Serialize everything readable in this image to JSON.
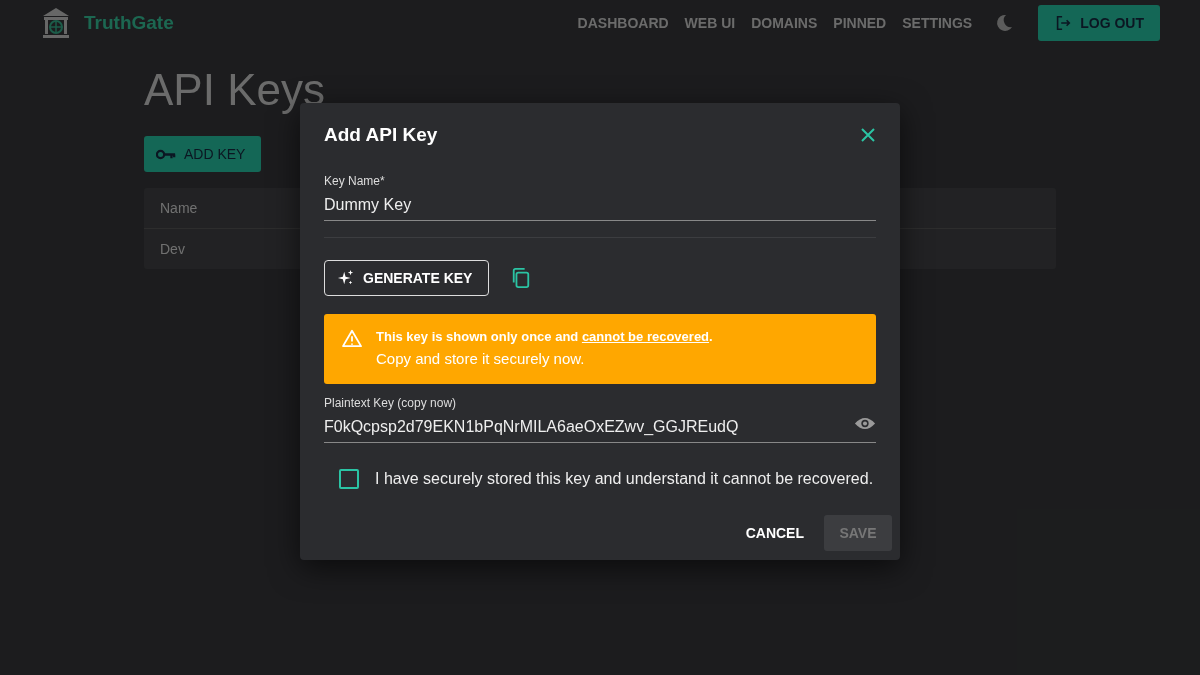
{
  "header": {
    "brand": "TruthGate",
    "nav": [
      {
        "label": "DASHBOARD"
      },
      {
        "label": "WEB UI"
      },
      {
        "label": "DOMAINS"
      },
      {
        "label": "PINNED"
      },
      {
        "label": "SETTINGS"
      }
    ],
    "logout": "LOG OUT"
  },
  "page": {
    "title": "API Keys",
    "add_button": "ADD KEY",
    "table": {
      "columns": [
        "Name"
      ],
      "rows": [
        [
          "Dev"
        ]
      ]
    }
  },
  "dialog": {
    "title": "Add API Key",
    "key_name": {
      "label": "Key Name*",
      "value": "Dummy Key"
    },
    "generate_button": "GENERATE KEY",
    "warning": {
      "text_before": "This key is shown only once and ",
      "link": "cannot be recovered",
      "text_after": ".",
      "line2": "Copy and store it securely now."
    },
    "plaintext": {
      "label": "Plaintext Key (copy now)",
      "value": "F0kQcpsp2d79EKN1bPqNrMILA6aeOxEZwv_GGJREudQ"
    },
    "confirm": {
      "label": "I have securely stored this key and understand it cannot be recovered.",
      "checked": false
    },
    "cancel": "CANCEL",
    "save": {
      "label": "SAVE",
      "disabled": true
    }
  }
}
